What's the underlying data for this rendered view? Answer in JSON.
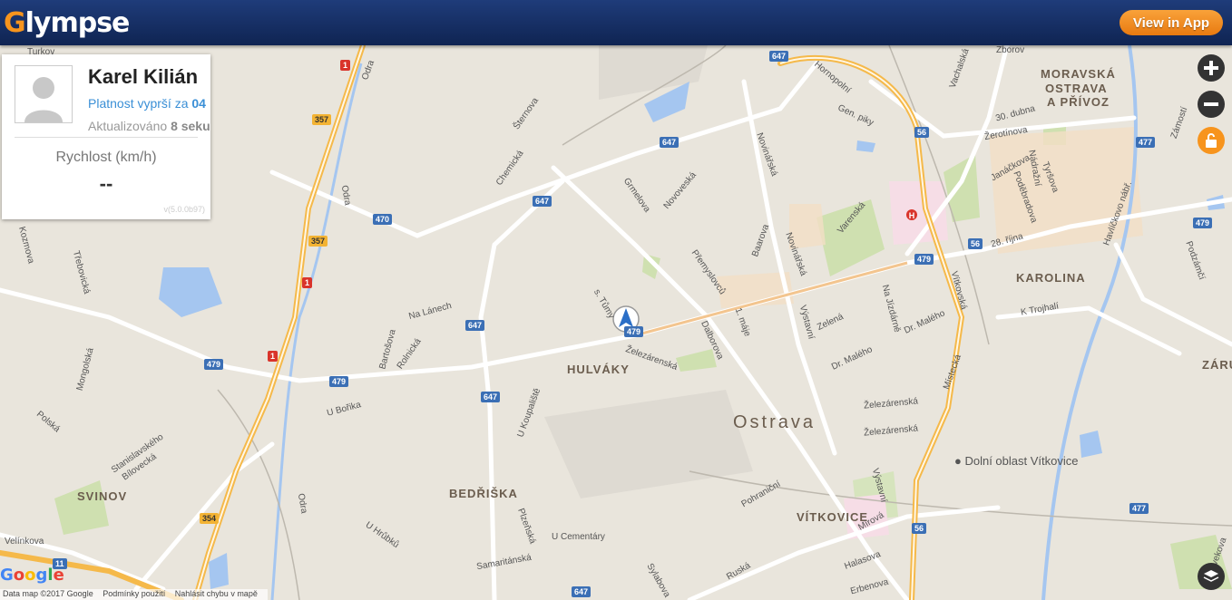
{
  "header": {
    "logo_text": "Glympse",
    "view_in_app_label": "View in App",
    "brand_color": "#f7941d",
    "header_color": "#1f3c7a"
  },
  "panel": {
    "name": "Karel Kilián",
    "expire_prefix": "Platnost vyprší za",
    "expire_value": "04",
    "updated_prefix": "Aktualizováno",
    "updated_value": "8 seku",
    "speed_label": "Rychlost (km/h)",
    "speed_value": "--",
    "version": "v(5.0.0b97)"
  },
  "controls": {
    "zoom_in_icon": "plus-icon",
    "zoom_out_icon": "minus-icon",
    "lock_icon": "unlock-icon",
    "layers_icon": "layers-icon"
  },
  "map": {
    "city": "Ostrava",
    "areas": {
      "hulvaky": "HULVÁKY",
      "bedriska": "BEDŘIŠKA",
      "svinov": "SVINOV",
      "vitkovice": "VÍTKOVICE",
      "karolina": "KAROLINA",
      "moravska1": "MORAVSKÁ",
      "moravska2": "OSTRAVA",
      "moravska3": "A PŘÍVOZ",
      "zaru": "ZÁRU"
    },
    "poi": "Dolní oblast Vítkovice",
    "streets": {
      "odra1": "Odra",
      "odra2": "Odra",
      "odra3": "Odra",
      "cheminicka": "Chemická",
      "sternova": "Šternova",
      "grmelova": "Grmelova",
      "novoveska": "Novoveská",
      "premyslovcu": "Přemyslovců",
      "novinarska1": "Novinářská",
      "novinarska2": "Novinářská",
      "baarova": "Baarova",
      "varenska": "Varenská",
      "homopolni": "Hornopolní",
      "genpiky": "Gen. piky",
      "tunyho": "s. Tůmy",
      "nalanech": "Na Lánech",
      "bartosova": "Bartošova",
      "rolnicka": "Rolnická",
      "zelezarenska1": "Železárenská",
      "zelezarenska2": "Železárenská",
      "zelezarenska3": "Železárenská",
      "dalborova": "Dalborova",
      "ukoupaliste": "U Koupaliště",
      "uborika": "U Bořika",
      "vystavni1": "Výstavní",
      "vystavni2": "Výstavní",
      "zelena": "Zelená",
      "drmaleho1": "Dr. Malého",
      "drmaleho2": "Dr. Malého",
      "najizdarne": "Na Jízdárně",
      "mistecka": "Místecká",
      "vitkovska": "Vítkovská",
      "ktrojhali": "K Trojhalí",
      "rijna": "28. října",
      "janackova": "Janáčkova",
      "nadrazni": "Nádražní",
      "tyrsova": "Tyršova",
      "podebradova": "Poděbradova",
      "zerotinova": "Žerotínova",
      "dubna": "30. dubna",
      "vachalska": "Vachalská",
      "zborova": "Zborov",
      "havlickovo": "Havlíčkovo nábř.",
      "zamosti": "Zámostí",
      "podzamci": "Podzámčí",
      "pohranicni": "Pohraniční",
      "mirova": "Mírová",
      "halasova": "Halasova",
      "ruska": "Ruská",
      "erbenova": "Erbenova",
      "plzenska": "Plzeňská",
      "ucementary": "U Cementáry",
      "samaritanska": "Samaritánská",
      "uhrubku": "U Hrůbků",
      "sylabova": "Sylabova",
      "mongolska": "Mongolská",
      "polska": "Polská",
      "stanislavskeho": "Stanislavského",
      "bilovecka": "Bílovecká",
      "velinkova": "Velínkova",
      "trebovicka": "Třebovická",
      "kozmova": "Kozmova",
      "holvekova": "Holvekova",
      "maje": "1. máje",
      "turkov": "Turkov"
    },
    "shields": {
      "s647a": "647",
      "s647b": "647",
      "s647c": "647",
      "s647d": "647",
      "s647e": "647",
      "s647f": "647",
      "s470": "470",
      "s479a": "479",
      "s479b": "479",
      "s479c": "479",
      "s479d": "479",
      "s479e": "479",
      "s477a": "477",
      "s477b": "477",
      "s56a": "56",
      "s56b": "56",
      "s56c": "56",
      "s1a": "1",
      "s1b": "1",
      "s1c": "1",
      "s357a": "357",
      "s357b": "357",
      "s354": "354",
      "s11": "11"
    }
  },
  "footer": {
    "google_logo": "Google",
    "data_text": "Data map ©2017 Google",
    "terms_text": "Podmínky použití",
    "report_text": "Nahlásit chybu v mapě"
  }
}
